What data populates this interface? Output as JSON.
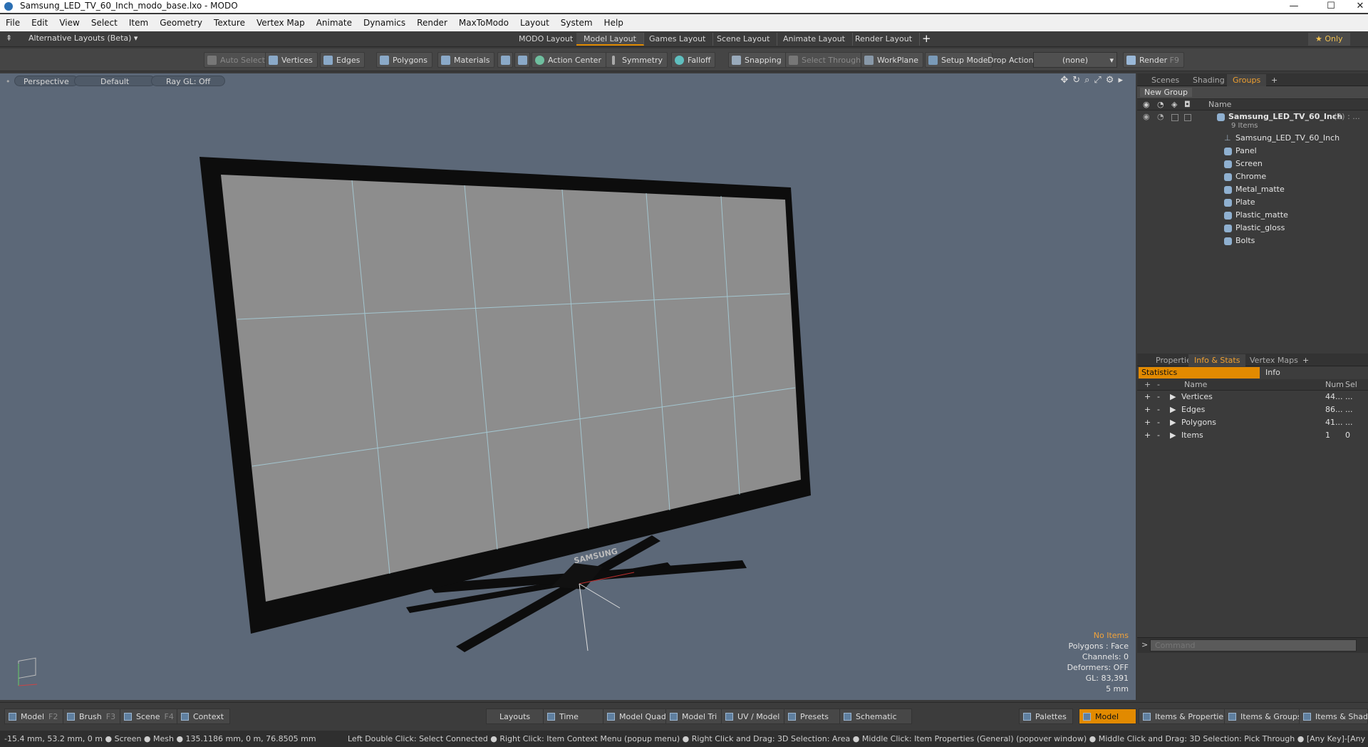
{
  "window": {
    "title": "Samsung_LED_TV_60_Inch_modo_base.lxo - MODO",
    "min": "—",
    "max": "☐",
    "close": "✕"
  },
  "menu": [
    "File",
    "Edit",
    "View",
    "Select",
    "Item",
    "Geometry",
    "Texture",
    "Vertex Map",
    "Animate",
    "Dynamics",
    "Render",
    "MaxToModo",
    "Layout",
    "System",
    "Help"
  ],
  "layoutbar": {
    "alt": "Alternative Layouts (Beta) ▾",
    "tabs": [
      "MODO Layout",
      "Model Layout",
      "Games Layout",
      "Scene Layout",
      "Animate Layout",
      "Render Layout"
    ],
    "plus": "+",
    "only": "★ Only"
  },
  "toolbar": {
    "auto_select": "Auto Select",
    "vertices": "Vertices",
    "edges": "Edges",
    "polygons": "Polygons",
    "materials": "Materials",
    "action_center": "Action Center",
    "symmetry": "Symmetry",
    "falloff": "Falloff",
    "snapping": "Snapping",
    "select_through": "Select Through",
    "workplane": "WorkPlane",
    "setup_mode": "Setup Mode",
    "drop_action": "Drop Action",
    "drop_value": "(none)",
    "render": "Render",
    "render_key": "F9"
  },
  "viewport": {
    "perspective": "Perspective",
    "default": "Default",
    "raygl": "Ray GL: Off",
    "brand": "SAMSUNG"
  },
  "hud": {
    "no_items": "No Items",
    "polygons": "Polygons : Face",
    "channels": "Channels: 0",
    "deformers": "Deformers: OFF",
    "gl": "GL: 83,391",
    "scale": "5 mm"
  },
  "groups_panel": {
    "tabs": [
      "Scenes",
      "Shading",
      "Groups"
    ],
    "plus": "+",
    "new_group": "New Group",
    "col_name": "Name",
    "root": "Samsung_LED_TV_60_Inch",
    "root_count": "(2) : ...",
    "items_count": "9 Items",
    "children": [
      "Samsung_LED_TV_60_Inch",
      "Panel",
      "Screen",
      "Chrome",
      "Metal_matte",
      "Plate",
      "Plastic_matte",
      "Plastic_gloss",
      "Bolts"
    ]
  },
  "stats_panel": {
    "tabs": [
      "Properties",
      "Info & Stats",
      "Vertex Maps"
    ],
    "plus": "+",
    "statistics": "Statistics",
    "info": "Info",
    "col_name": "Name",
    "col_num": "Num",
    "col_sel": "Sel",
    "rows": [
      {
        "name": "Vertices",
        "num": "44...",
        "sel": "..."
      },
      {
        "name": "Edges",
        "num": "86...",
        "sel": "..."
      },
      {
        "name": "Polygons",
        "num": "41...",
        "sel": "..."
      },
      {
        "name": "Items",
        "num": "1",
        "sel": "0"
      }
    ]
  },
  "command": {
    "prompt": ">",
    "placeholder": "Command"
  },
  "bottom": {
    "model": "Model",
    "model_key": "F2",
    "brush": "Brush",
    "brush_key": "F3",
    "scene": "Scene",
    "scene_key": "F4",
    "context": "Context",
    "layouts": "Layouts",
    "time": "Time",
    "model_quad": "Model Quad",
    "model_tri": "Model Tri",
    "uv_model": "UV / Model",
    "presets": "Presets",
    "schematic": "Schematic",
    "palettes": "Palettes",
    "model_active": "Model",
    "items_props": "Items & Properties",
    "items_groups": "Items & Groups",
    "items_shading": "Items & Shading"
  },
  "status": {
    "coords": "-15.4 mm, 53.2 mm, 0 m ● Screen ● Mesh ● 135.1186 mm, 0 m, 76.8505 mm",
    "hints": "Left Double Click: Select Connected ● Right Click: Item Context Menu (popup menu) ● Right Click and Drag: 3D Selection: Area ● Middle Click: Item Properties (General) (popover window) ● Middle Click and Drag: 3D Selection: Pick Through ● [Any Key]-[Any Button] Click and Drag: dragDrop"
  },
  "colors": {
    "viewport_bg": "#5c6878",
    "accent": "#e28a00",
    "screen": "#8d8d8d",
    "bezel": "#0d0d0d"
  }
}
